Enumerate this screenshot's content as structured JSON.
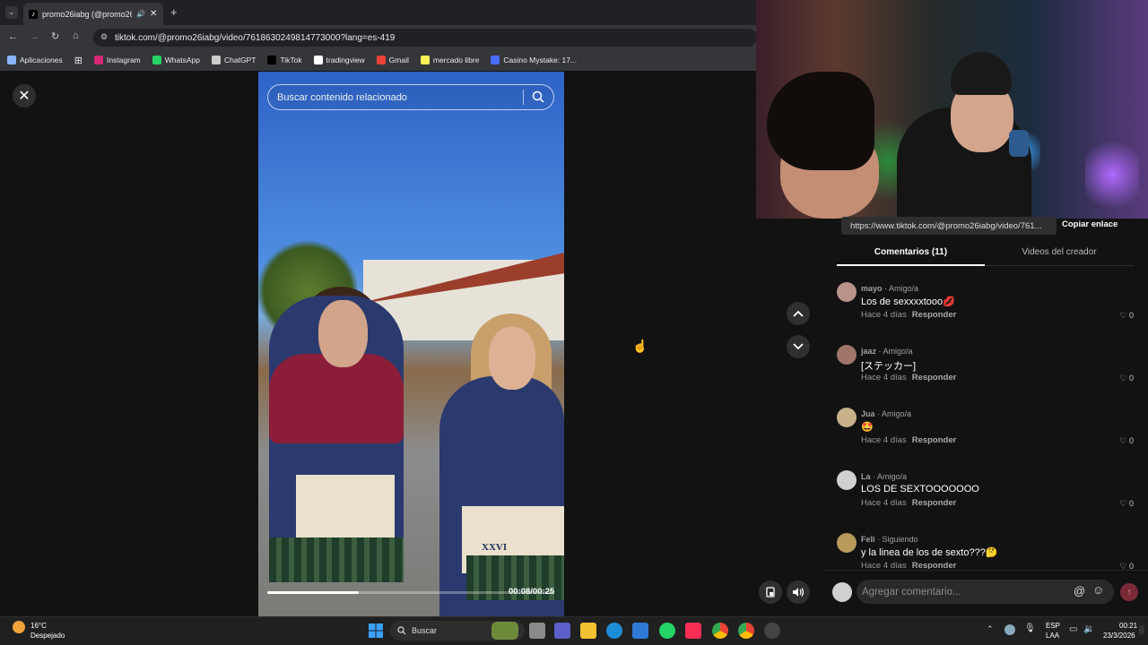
{
  "browser": {
    "tab_title": "promo26iabg (@promo26ia",
    "new_tab": "+",
    "url": "tiktok.com/@promo26iabg/video/7618630249814773000?lang=es-419",
    "bookmarks": [
      {
        "label": "Aplicaciones",
        "color": "#8ab4f8"
      },
      {
        "label": "Instagram",
        "color": "#d62976"
      },
      {
        "label": "WhatsApp",
        "color": "#25d366"
      },
      {
        "label": "ChatGPT",
        "color": "#cccccc"
      },
      {
        "label": "TikTok",
        "color": "#000000"
      },
      {
        "label": "tradingview",
        "color": "#ffffff"
      },
      {
        "label": "Gmail",
        "color": "#ea4335"
      },
      {
        "label": "mercado libre",
        "color": "#fff159"
      },
      {
        "label": "Casino Mystake: 17...",
        "color": "#4a6cf7"
      }
    ]
  },
  "video": {
    "search_placeholder": "Buscar contenido relacionado",
    "timecode": "00:08/00:25",
    "progress": 0.32,
    "hoodie_text": "XXVI"
  },
  "side": {
    "link": "https://www.tiktok.com/@promo26iabg/video/761...",
    "copy_link": "Copiar enlace",
    "tab_comments": "Comentarios (11)",
    "tab_videos": "Videos del creador",
    "reply_label": "Responder",
    "comments": [
      {
        "user": "mayo",
        "rel": " · Amigo/a",
        "text": "Los de sexxxxtooo💋",
        "time": "Hace 4 días",
        "likes": "0",
        "avatar": "#b9938a"
      },
      {
        "user": "jaaz",
        "rel": " · Amigo/a",
        "text": "[ステッカー]",
        "time": "Hace 4 días",
        "likes": "0",
        "avatar": "#a0766a"
      },
      {
        "user": "Jua",
        "rel": " · Amigo/a",
        "text": "🤩",
        "time": "Hace 4 días",
        "likes": "0",
        "avatar": "#c7b08a"
      },
      {
        "user": "La",
        "rel": " · Amigo/a",
        "text": "LOS DE SEXTOOOOOOO",
        "time": "Hace 4 días",
        "likes": "0",
        "avatar": "#d0d0d0"
      },
      {
        "user": "Feli",
        "rel": " · Siguiendo",
        "text": "y la linea de los de sexto???🤔",
        "time": "Hace 4 días",
        "likes": "0",
        "avatar": "#b89a5a"
      }
    ],
    "comment_placeholder": "Agregar comentario..."
  },
  "taskbar": {
    "temp": "16°C",
    "weather": "Despejado",
    "search": "Buscar",
    "lang1": "ESP",
    "lang2": "LAA",
    "time": "00:21",
    "date": "23/3/2026"
  }
}
